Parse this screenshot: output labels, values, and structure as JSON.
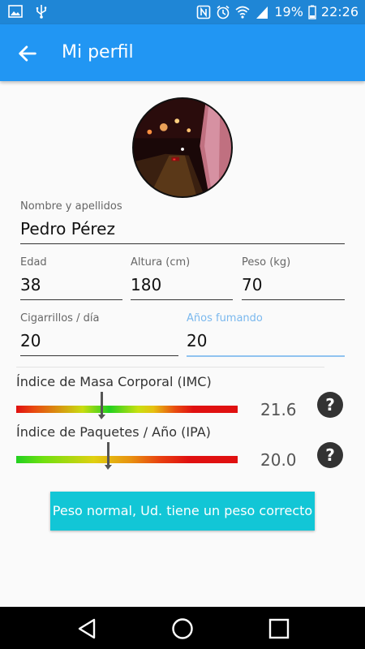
{
  "status_bar": {
    "battery": "19%",
    "time": "22:26"
  },
  "header": {
    "title": "Mi perfil",
    "back_icon": "arrow-left-icon"
  },
  "profile": {
    "name_label": "Nombre y apellidos",
    "name_value": "Pedro Pérez",
    "age_label": "Edad",
    "age_value": "38",
    "height_label": "Altura (cm)",
    "height_value": "180",
    "weight_label": "Peso (kg)",
    "weight_value": "70",
    "cigs_label": "Cigarrillos / día",
    "cigs_value": "20",
    "years_label": "Años fumando",
    "years_value": "20"
  },
  "indices": {
    "imc_title": "Índice de Masa Corporal (IMC)",
    "imc_value": "21.6",
    "imc_marker_fraction": 0.385,
    "ipa_title": "Índice de Paquetes / Año (IPA)",
    "ipa_value": "20.0",
    "ipa_marker_fraction": 0.415,
    "help_label": "?"
  },
  "result": {
    "text": "Peso normal, Ud. tiene un peso correcto"
  },
  "colors": {
    "status_bar": "#1f86d6",
    "app_bar": "#2196f3",
    "result_button": "#12c6d6",
    "active_label": "#7ab8ee"
  }
}
